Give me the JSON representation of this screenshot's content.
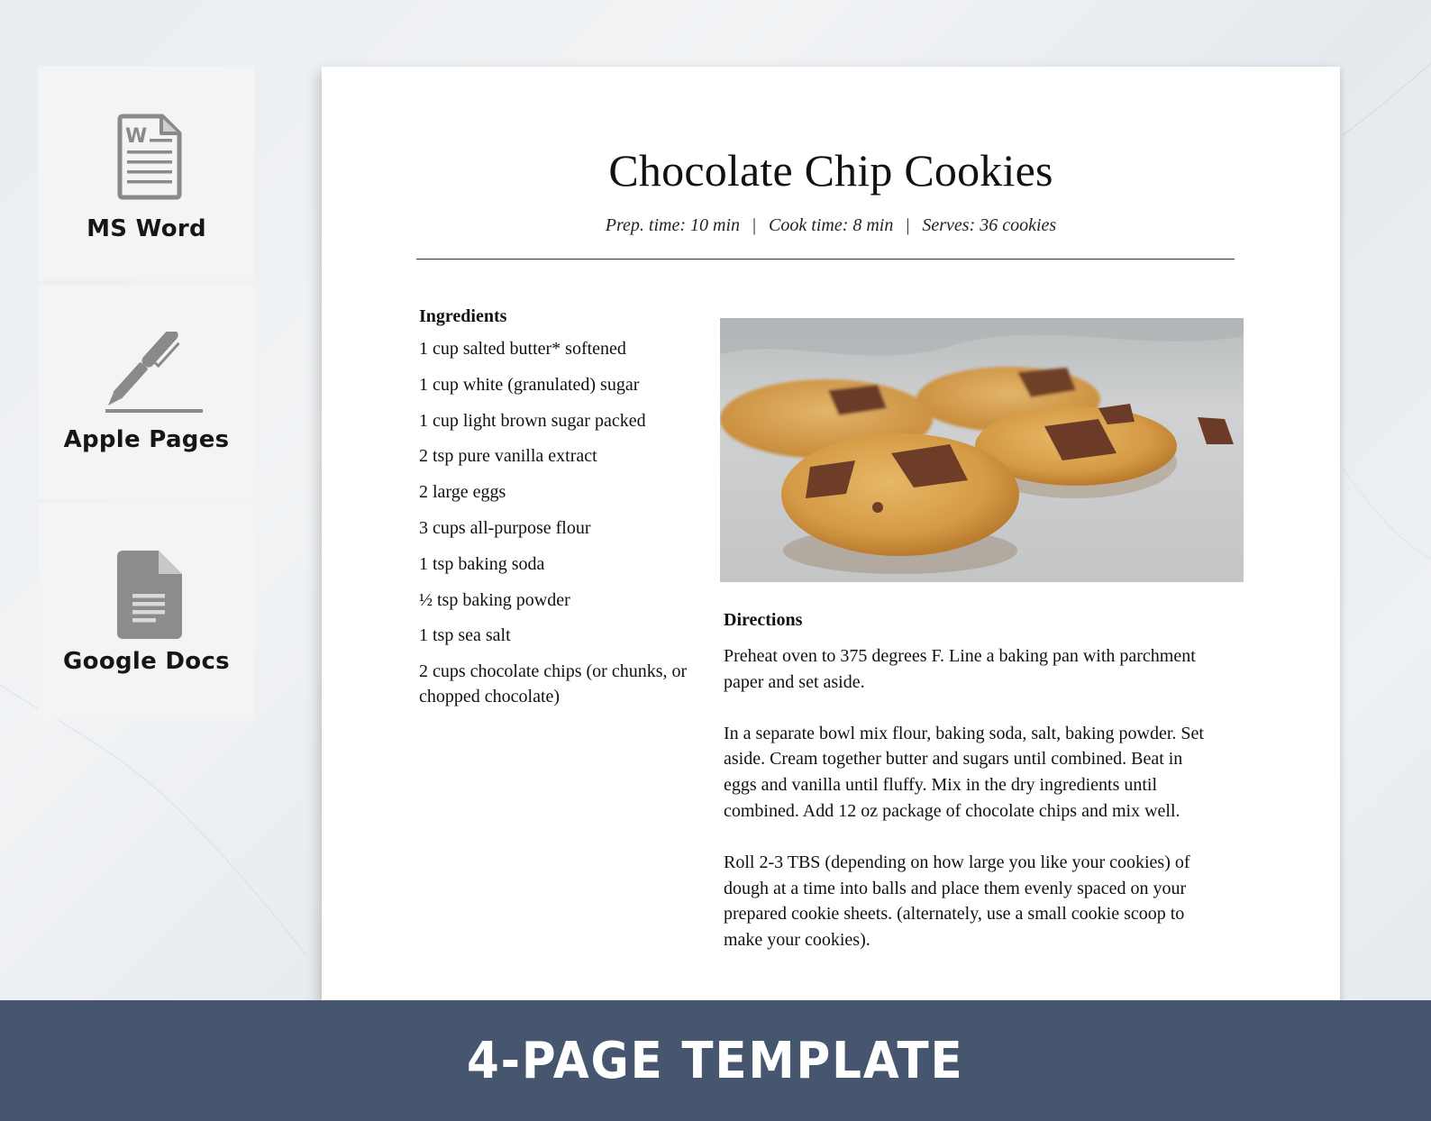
{
  "sidebar": {
    "apps": [
      {
        "label": "MS Word",
        "icon": "word-document-icon"
      },
      {
        "label": "Apple Pages",
        "icon": "pen-icon"
      },
      {
        "label": "Google Docs",
        "icon": "google-docs-icon"
      }
    ]
  },
  "document": {
    "title": "Chocolate Chip Cookies",
    "meta": {
      "prep": "Prep. time: 10 min",
      "cook": "Cook time: 8 min",
      "serves": "Serves: 36 cookies",
      "separator": "|"
    },
    "ingredients": {
      "heading": "Ingredients",
      "items": [
        "1 cup salted butter* softened",
        "1 cup white (granulated) sugar",
        "1 cup light brown sugar packed",
        "2 tsp pure vanilla extract",
        "2 large eggs",
        "3 cups all-purpose flour",
        "1 tsp baking soda",
        "½ tsp baking powder",
        "1 tsp sea salt",
        "2 cups chocolate chips (or chunks, or chopped chocolate)"
      ]
    },
    "photo": {
      "alt": "Chocolate chip cookies on parchment paper"
    },
    "directions": {
      "heading": "Directions",
      "steps": [
        "Preheat oven to 375 degrees F. Line a baking pan with parchment paper and set aside.",
        "In a separate bowl mix flour, baking soda, salt, baking powder. Set aside. Cream together butter and sugars until combined. Beat in eggs and vanilla until fluffy. Mix in the dry ingredients until combined. Add 12 oz package of chocolate chips and mix well.",
        "Roll 2-3 TBS (depending on how large you like your cookies) of dough at a time into balls and place them evenly spaced on your prepared cookie sheets. (alternately, use a small cookie scoop to make your cookies)."
      ]
    }
  },
  "banner": {
    "text": "4-PAGE TEMPLATE",
    "color": "#46566e"
  },
  "colors": {
    "icon_gray": "#8a8a8a",
    "card_bg": "#f4f4f4"
  }
}
